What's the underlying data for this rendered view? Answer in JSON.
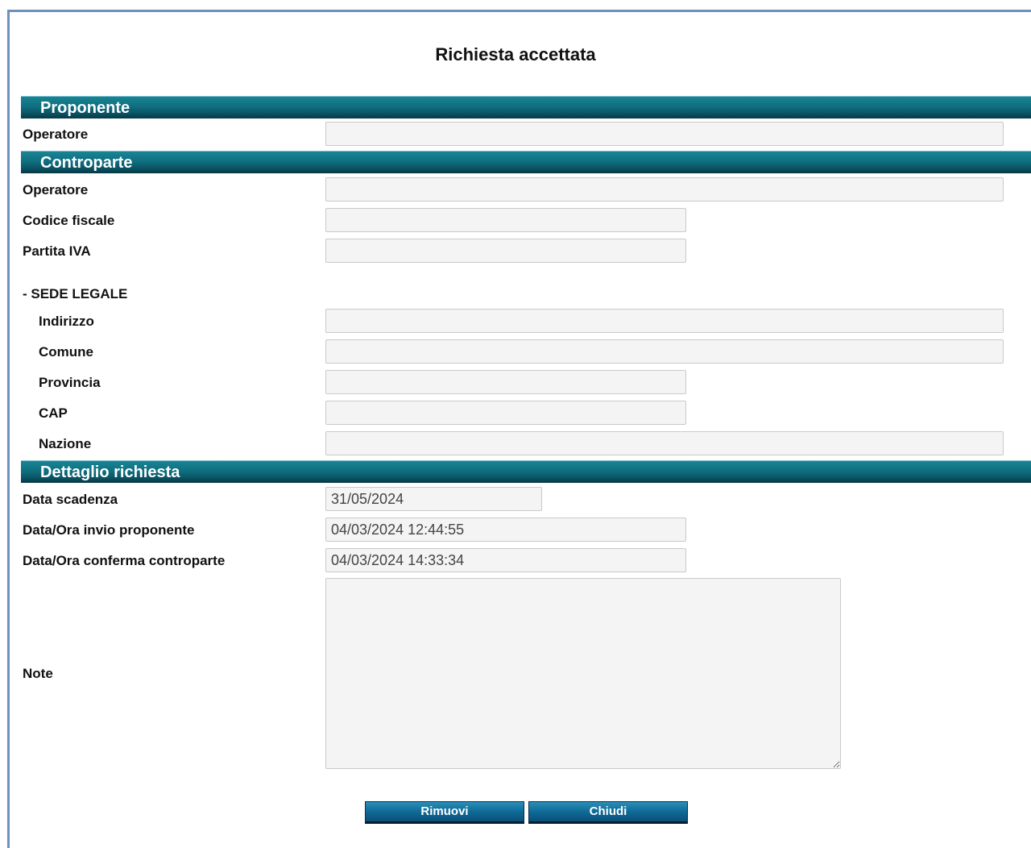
{
  "title": "Richiesta accettata",
  "sections": {
    "proponente": {
      "header": "Proponente",
      "operatore_label": "Operatore",
      "operatore_value": ""
    },
    "controparte": {
      "header": "Controparte",
      "operatore_label": "Operatore",
      "operatore_value": "",
      "codice_fiscale_label": "Codice fiscale",
      "codice_fiscale_value": "",
      "partita_iva_label": "Partita IVA",
      "partita_iva_value": "",
      "sede_legale_label": "- SEDE LEGALE",
      "indirizzo_label": "Indirizzo",
      "indirizzo_value": "",
      "comune_label": "Comune",
      "comune_value": "",
      "provincia_label": "Provincia",
      "provincia_value": "",
      "cap_label": "CAP",
      "cap_value": "",
      "nazione_label": "Nazione",
      "nazione_value": ""
    },
    "dettaglio": {
      "header": "Dettaglio richiesta",
      "data_scadenza_label": "Data scadenza",
      "data_scadenza_value": "31/05/2024",
      "invio_label": "Data/Ora invio proponente",
      "invio_value": "04/03/2024 12:44:55",
      "conferma_label": "Data/Ora conferma controparte",
      "conferma_value": "04/03/2024 14:33:34",
      "note_label": "Note",
      "note_value": ""
    }
  },
  "buttons": {
    "rimuovi": "Rimuovi",
    "chiudi": "Chiudi"
  },
  "colors": {
    "section_header": "#0f6f80",
    "button": "#0f6a96",
    "frame_border": "#6f8fbd"
  }
}
